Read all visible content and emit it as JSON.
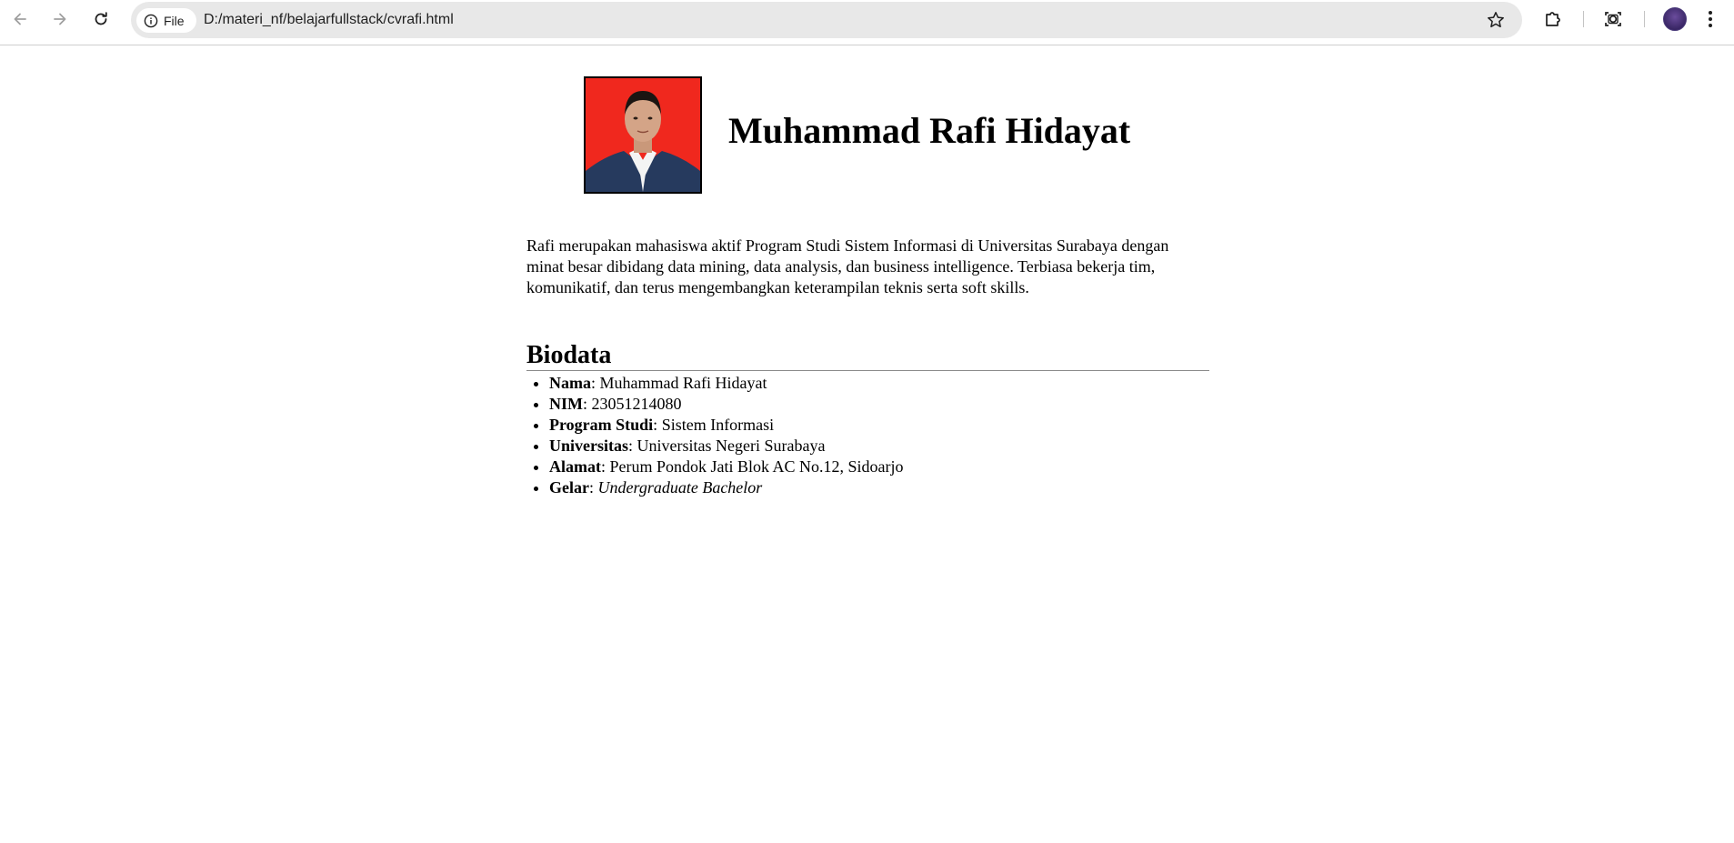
{
  "browser": {
    "back_icon": "arrow-left-icon",
    "forward_icon": "arrow-right-icon",
    "reload_icon": "reload-icon",
    "chip_label": "File",
    "url": "D:/materi_nf/belajarfullstack/cvrafi.html",
    "bookmark_icon": "star-icon",
    "extensions_icon": "puzzle-icon",
    "lens_icon": "camera-search-icon",
    "menu_icon": "three-dots-icon"
  },
  "profile": {
    "name": "Muhammad Rafi Hidayat",
    "photo_background_color": "#f0281e",
    "intro": "Rafi merupakan mahasiswa aktif Program Studi Sistem Informasi di Universitas Surabaya dengan minat besar dibidang data mining, data analysis, dan business intelligence. Terbiasa bekerja tim, komunikatif, dan terus mengembangkan keterampilan teknis serta soft skills."
  },
  "biodata": {
    "heading": "Biodata",
    "separator": ": ",
    "items": [
      {
        "label": "Nama",
        "value": "Muhammad Rafi Hidayat"
      },
      {
        "label": "NIM",
        "value": "23051214080"
      },
      {
        "label": "Program Studi",
        "value": "Sistem Informasi"
      },
      {
        "label": "Universitas",
        "value": "Universitas Negeri Surabaya"
      },
      {
        "label": "Alamat",
        "value": "Perum Pondok Jati Blok AC No.12, Sidoarjo"
      },
      {
        "label": "Gelar",
        "value": "Undergraduate Bachelor"
      }
    ]
  }
}
